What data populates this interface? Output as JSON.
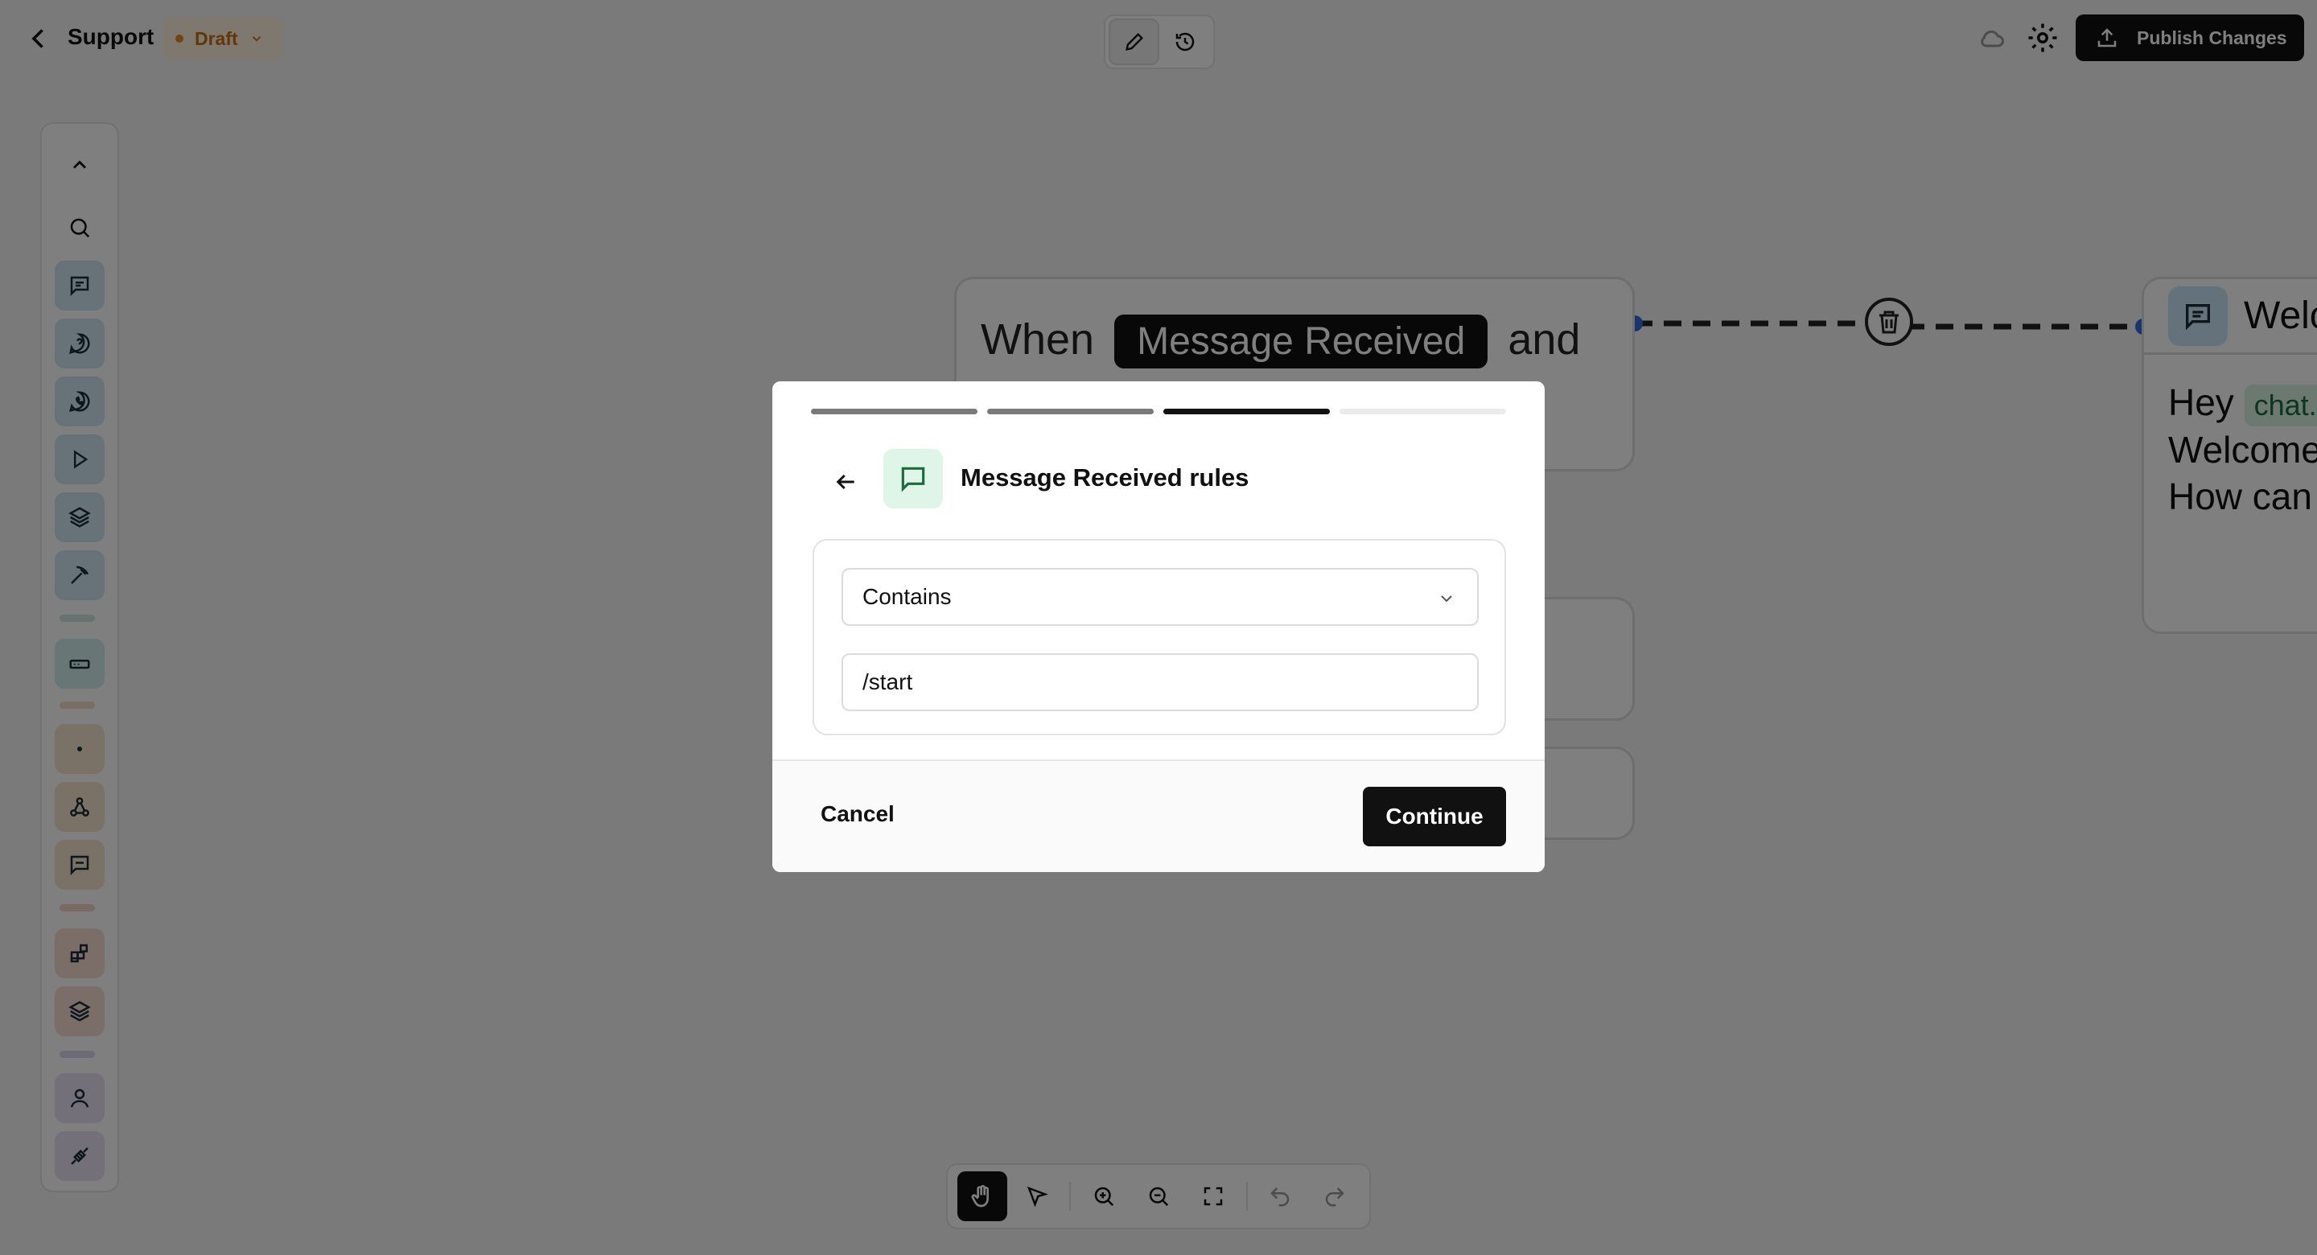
{
  "header": {
    "back_icon": "chevron-left-icon",
    "title": "Support",
    "status_badge": "Draft",
    "publish_label": "Publish Changes"
  },
  "canvas": {
    "trigger_node": {
      "prefix": "When",
      "event": "Message Received",
      "suffix": "and"
    },
    "message_node": {
      "title": "Welc",
      "greeting": "Hey",
      "variable": "chat.",
      "line2": "Welcome",
      "line3": "How can"
    }
  },
  "modal": {
    "progress_steps_total": 4,
    "progress_current_step": 3,
    "title": "Message Received rules",
    "condition_select": {
      "selected": "Contains"
    },
    "value_input": {
      "value": "/start"
    },
    "cancel_label": "Cancel",
    "continue_label": "Continue"
  },
  "colors": {
    "draft_accent": "#c46d12",
    "edge_handle": "#2f6de0",
    "message_icon_bg": "#dff5e8",
    "primary_button": "#111111"
  }
}
